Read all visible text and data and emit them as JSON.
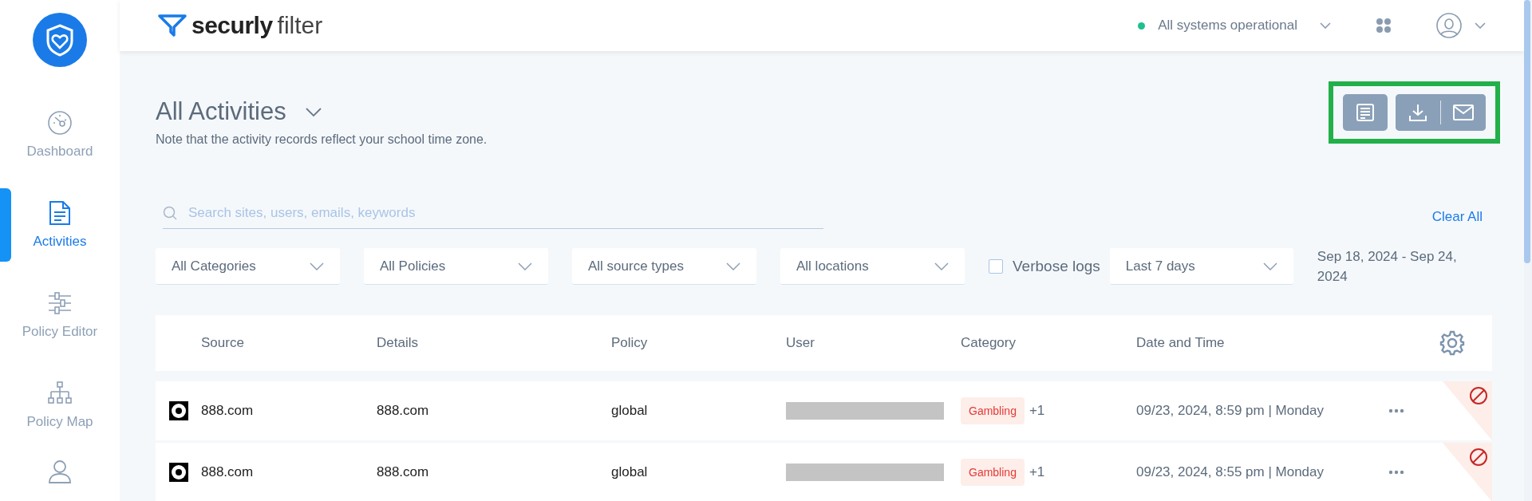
{
  "sidebar": {
    "items": [
      {
        "kind": "dashboard",
        "label": "Dashboard",
        "selected": false
      },
      {
        "kind": "activities",
        "label": "Activities",
        "selected": true
      },
      {
        "kind": "editor",
        "label": "Policy Editor",
        "selected": false
      },
      {
        "kind": "map",
        "label": "Policy Map",
        "selected": false
      },
      {
        "kind": "users",
        "selected": false
      }
    ]
  },
  "header": {
    "logo": {
      "brand": "securly",
      "product": "filter"
    },
    "status": {
      "text": "All systems operational",
      "color": "#1fbf8f"
    }
  },
  "page": {
    "title": "All Activities",
    "note": "Note that the activity records reflect your school time zone.",
    "export_toolbar": {
      "highlighted": true
    }
  },
  "search": {
    "placeholder": "Search sites, users, emails, keywords"
  },
  "clear_all": "Clear All",
  "filters": [
    {
      "value": "All Categories"
    },
    {
      "value": "All Policies"
    },
    {
      "value": "All source types"
    },
    {
      "value": "All locations"
    }
  ],
  "verbose_logs": {
    "label": "Verbose logs",
    "checked": false
  },
  "date_range": {
    "value": "Last 7 days",
    "text": "Sep 18, 2024 -  Sep 24, 2024"
  },
  "table": {
    "columns": [
      "Source",
      "Details",
      "Policy",
      "User",
      "Category",
      "Date and Time"
    ],
    "rows": [
      {
        "source": "888.com",
        "details": "888.com",
        "policy": "global",
        "user_redacted": true,
        "category": "Gambling",
        "extra": "+1",
        "datetime": "09/23, 2024, 8:59 pm | Monday",
        "blocked": true
      },
      {
        "source": "888.com",
        "details": "888.com",
        "policy": "global",
        "user_redacted": true,
        "category": "Gambling",
        "extra": "+1",
        "datetime": "09/23, 2024, 8:55 pm | Monday",
        "blocked": true
      }
    ]
  }
}
